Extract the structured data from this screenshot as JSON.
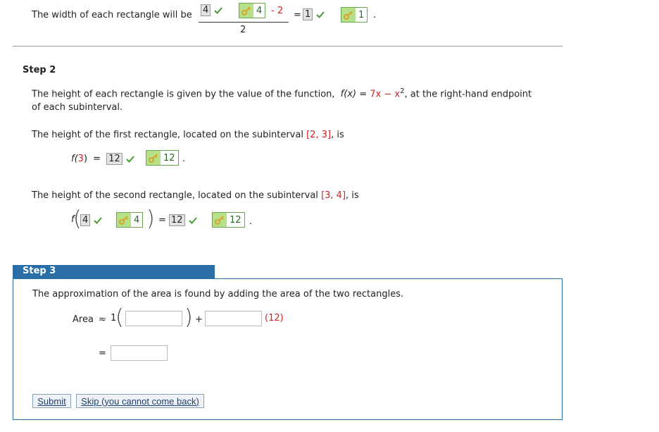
{
  "step1": {
    "intro": "The width of each rectangle will be",
    "num_answer": "4",
    "num_key": "4",
    "minus_val": "- 2",
    "denominator": "2",
    "equals": "=",
    "result_answer": "1",
    "result_key": "1",
    "period": "."
  },
  "step2": {
    "title": "Step 2",
    "desc_a": "The height of each rectangle is given by the value of the function,",
    "func_f": "f(x)",
    "func_eq": "=",
    "func_rhs": "7x − x",
    "func_exp": "2",
    "desc_b": ", at the right-hand endpoint",
    "desc_c": "of each subinterval.",
    "first_text": "The height of the first rectangle, located on the subinterval",
    "first_interval": "[2, 3]",
    "is_word": ", is",
    "first_f": "f(",
    "first_arg": "3",
    "first_close": ")",
    "first_eq": "=",
    "first_answer": "12",
    "first_key": "12",
    "first_period": ".",
    "second_text": "The height of the second rectangle, located on the subinterval",
    "second_interval": "[3, 4]",
    "second_is": ", is",
    "second_f": "f",
    "second_arg_answer": "4",
    "second_arg_key": "4",
    "second_eq": "=",
    "second_answer": "12",
    "second_key": "12",
    "second_period": "."
  },
  "step3": {
    "title": "Step 3",
    "desc": "The approximation of the area is found by adding the area of the two rectangles.",
    "area_label": "Area",
    "approx": "≈",
    "coef": "1",
    "plus": "+",
    "given": "(12)",
    "equals": "=",
    "submit_label": "Submit",
    "skip_label": "Skip (you cannot come back)"
  },
  "colors": {
    "accent": "#2a6ea8",
    "correct": "#4a9a3a",
    "highlight": "#cc2222"
  }
}
